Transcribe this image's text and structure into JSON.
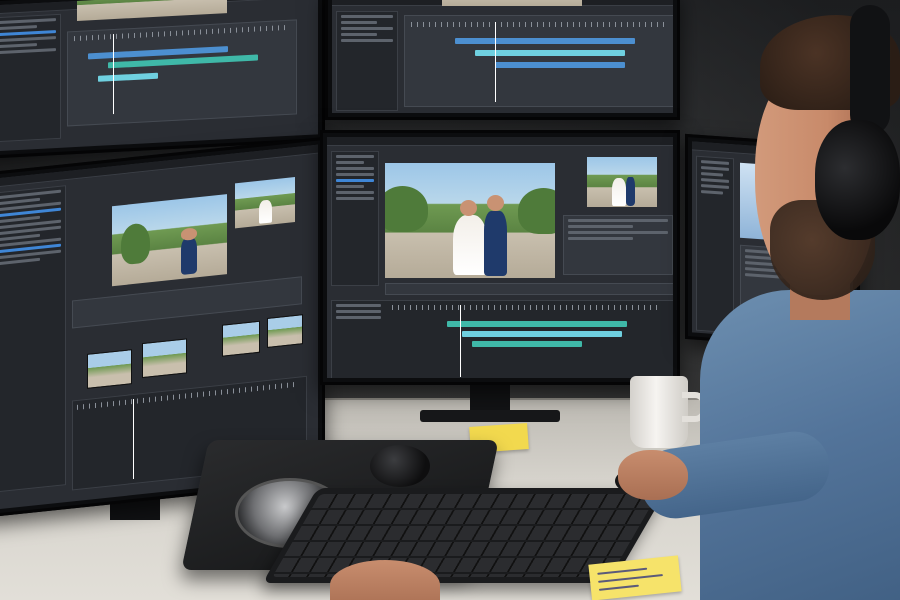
{
  "scene": {
    "description_tags": [
      "monitor-array",
      "video-editing-software",
      "wedding-footage",
      "editor-person",
      "jog-shuttle-controller"
    ]
  },
  "colors": {
    "timeline_teal": "#3fb8a8",
    "timeline_blue": "#4c8fd0",
    "ui_panel": "#33373e",
    "sticky_note": "#f2d94e"
  }
}
